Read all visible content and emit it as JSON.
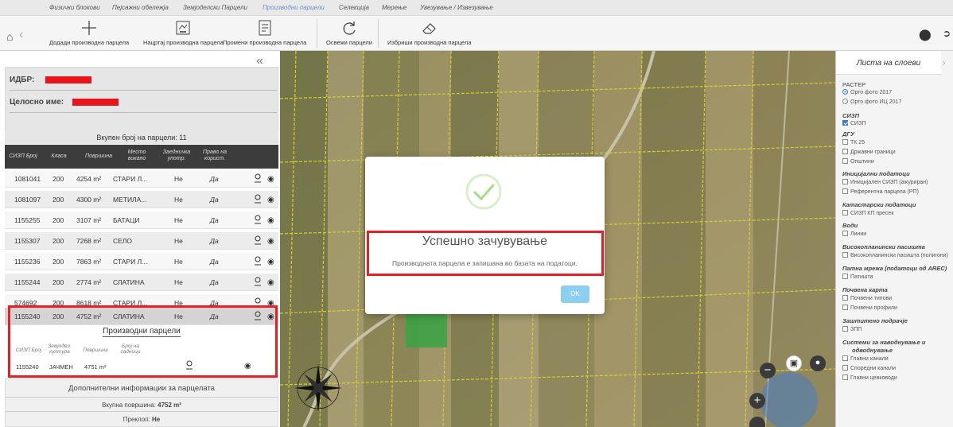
{
  "top_menu": {
    "tabs": [
      {
        "label": "Физички блокови"
      },
      {
        "label": "Пејсажни обележја"
      },
      {
        "label": "Земјоделски Парцели"
      },
      {
        "label": "Производни парцели"
      },
      {
        "label": "Селекција"
      },
      {
        "label": "Мерење"
      },
      {
        "label": "Увезување / Извезување"
      }
    ],
    "active_tab": "Производни парцели"
  },
  "toolbar": {
    "add_label": "Додади производна парцела",
    "draw_label": "Нацртај производна парцела",
    "change_label": "Промени производна парцела",
    "refresh_label": "Освежи парцели",
    "delete_label": "Избриши производна парцела"
  },
  "farmer": {
    "id_label": "ИДБР:",
    "name_label": "Целосно име:"
  },
  "parcels": {
    "count_text": "Вкупен број на парцели: 11",
    "columns": [
      "СИЗП Број",
      "Класа",
      "Површина",
      "Место викано",
      "Заедничка употр.",
      "Право на корист."
    ],
    "rows": [
      {
        "id": "1081041",
        "klasa": "200",
        "area": "4254 m²",
        "place": "СТАРИ Л...",
        "common": "Не",
        "right": "Да"
      },
      {
        "id": "1081097",
        "klasa": "200",
        "area": "4300 m²",
        "place": "МЕТИЛА...",
        "common": "Не",
        "right": "Да"
      },
      {
        "id": "1155255",
        "klasa": "200",
        "area": "3107 m²",
        "place": "БАТАЦИ",
        "common": "Не",
        "right": "Да"
      },
      {
        "id": "1155307",
        "klasa": "200",
        "area": "7268 m²",
        "place": "СЕЛО",
        "common": "Не",
        "right": "Да"
      },
      {
        "id": "1155236",
        "klasa": "200",
        "area": "7863 m²",
        "place": "СТАРИ Л...",
        "common": "Не",
        "right": "Да"
      },
      {
        "id": "1155244",
        "klasa": "200",
        "area": "2774 m²",
        "place": "СЛАТИНА",
        "common": "Не",
        "right": "Да"
      },
      {
        "id": "574692",
        "klasa": "200",
        "area": "8618 m²",
        "place": "СТАРИ Л...",
        "common": "Не",
        "right": "Да"
      },
      {
        "id": "1155240",
        "klasa": "200",
        "area": "4752 m²",
        "place": "СЛАТИНА",
        "common": "Не",
        "right": "Да"
      }
    ]
  },
  "production": {
    "title": "Производни парцели",
    "columns": [
      "СИЗП Број",
      "Земјодел. култура",
      "Површина",
      "Број на садници"
    ],
    "row": {
      "id": "1155240",
      "crop": "ЈАЧМЕН",
      "area": "4751 m²"
    }
  },
  "extra": {
    "title": "Дополнителни информации за парцелата",
    "total_label": "Вкупна површина:",
    "total_value": "4752 m²",
    "overlap_label": "Преклоп:",
    "overlap_value": "Не"
  },
  "modal": {
    "title": "Успешно зачувување",
    "message": "Производната парцела е запишана во базата на податоци.",
    "ok_label": "OK"
  },
  "layers": {
    "tab_label": "Листа на слоеви",
    "raster_group": "РАСТЕР",
    "raster_1": "Орто фото 2017",
    "raster_2": "Орто фото ИЦ 2017",
    "sizp_group": "СИЗП",
    "sizp_item": "СИЗП",
    "dgu_group": "ДГУ",
    "dgu_1": "ТК 25",
    "dgu_2": "Државни граници",
    "dgu_3": "Општини",
    "init_group": "Иницијални податоци",
    "init_1": "Иницијален СИЗП (ажуриран)",
    "init_2": "Референтна парцела (РП)",
    "cad_group": "Катастарски податоци",
    "cad_1": "СИЗП КП пресек",
    "water_group": "Води",
    "water_1": "Линии",
    "pasture_group": "Високопланински пасишта",
    "pasture_1": "Високопланински пасишта (полигони)",
    "road_group": "Патна мрежа (податоци од AREC)",
    "road_1": "Патишта",
    "soil_group": "Почвена карта",
    "soil_1": "Почвени типови",
    "soil_2": "Почвени профили",
    "prot_group": "Заштитено подрачје",
    "prot_1": "ЗПП",
    "irr_group_1": "Системи за наводнување и",
    "irr_group_2": "одводнување",
    "irr_1": "Главни канали",
    "irr_2": "Споредни канали",
    "irr_3": "Главни цевководи"
  },
  "colors": {
    "accent": "#6d8fc9",
    "highlight": "#e41f26",
    "success": "#a5dc86",
    "ok_button": "#8ccfef",
    "parcel_line": "#e8df3a",
    "selected_parcel": "#3cb24a"
  }
}
